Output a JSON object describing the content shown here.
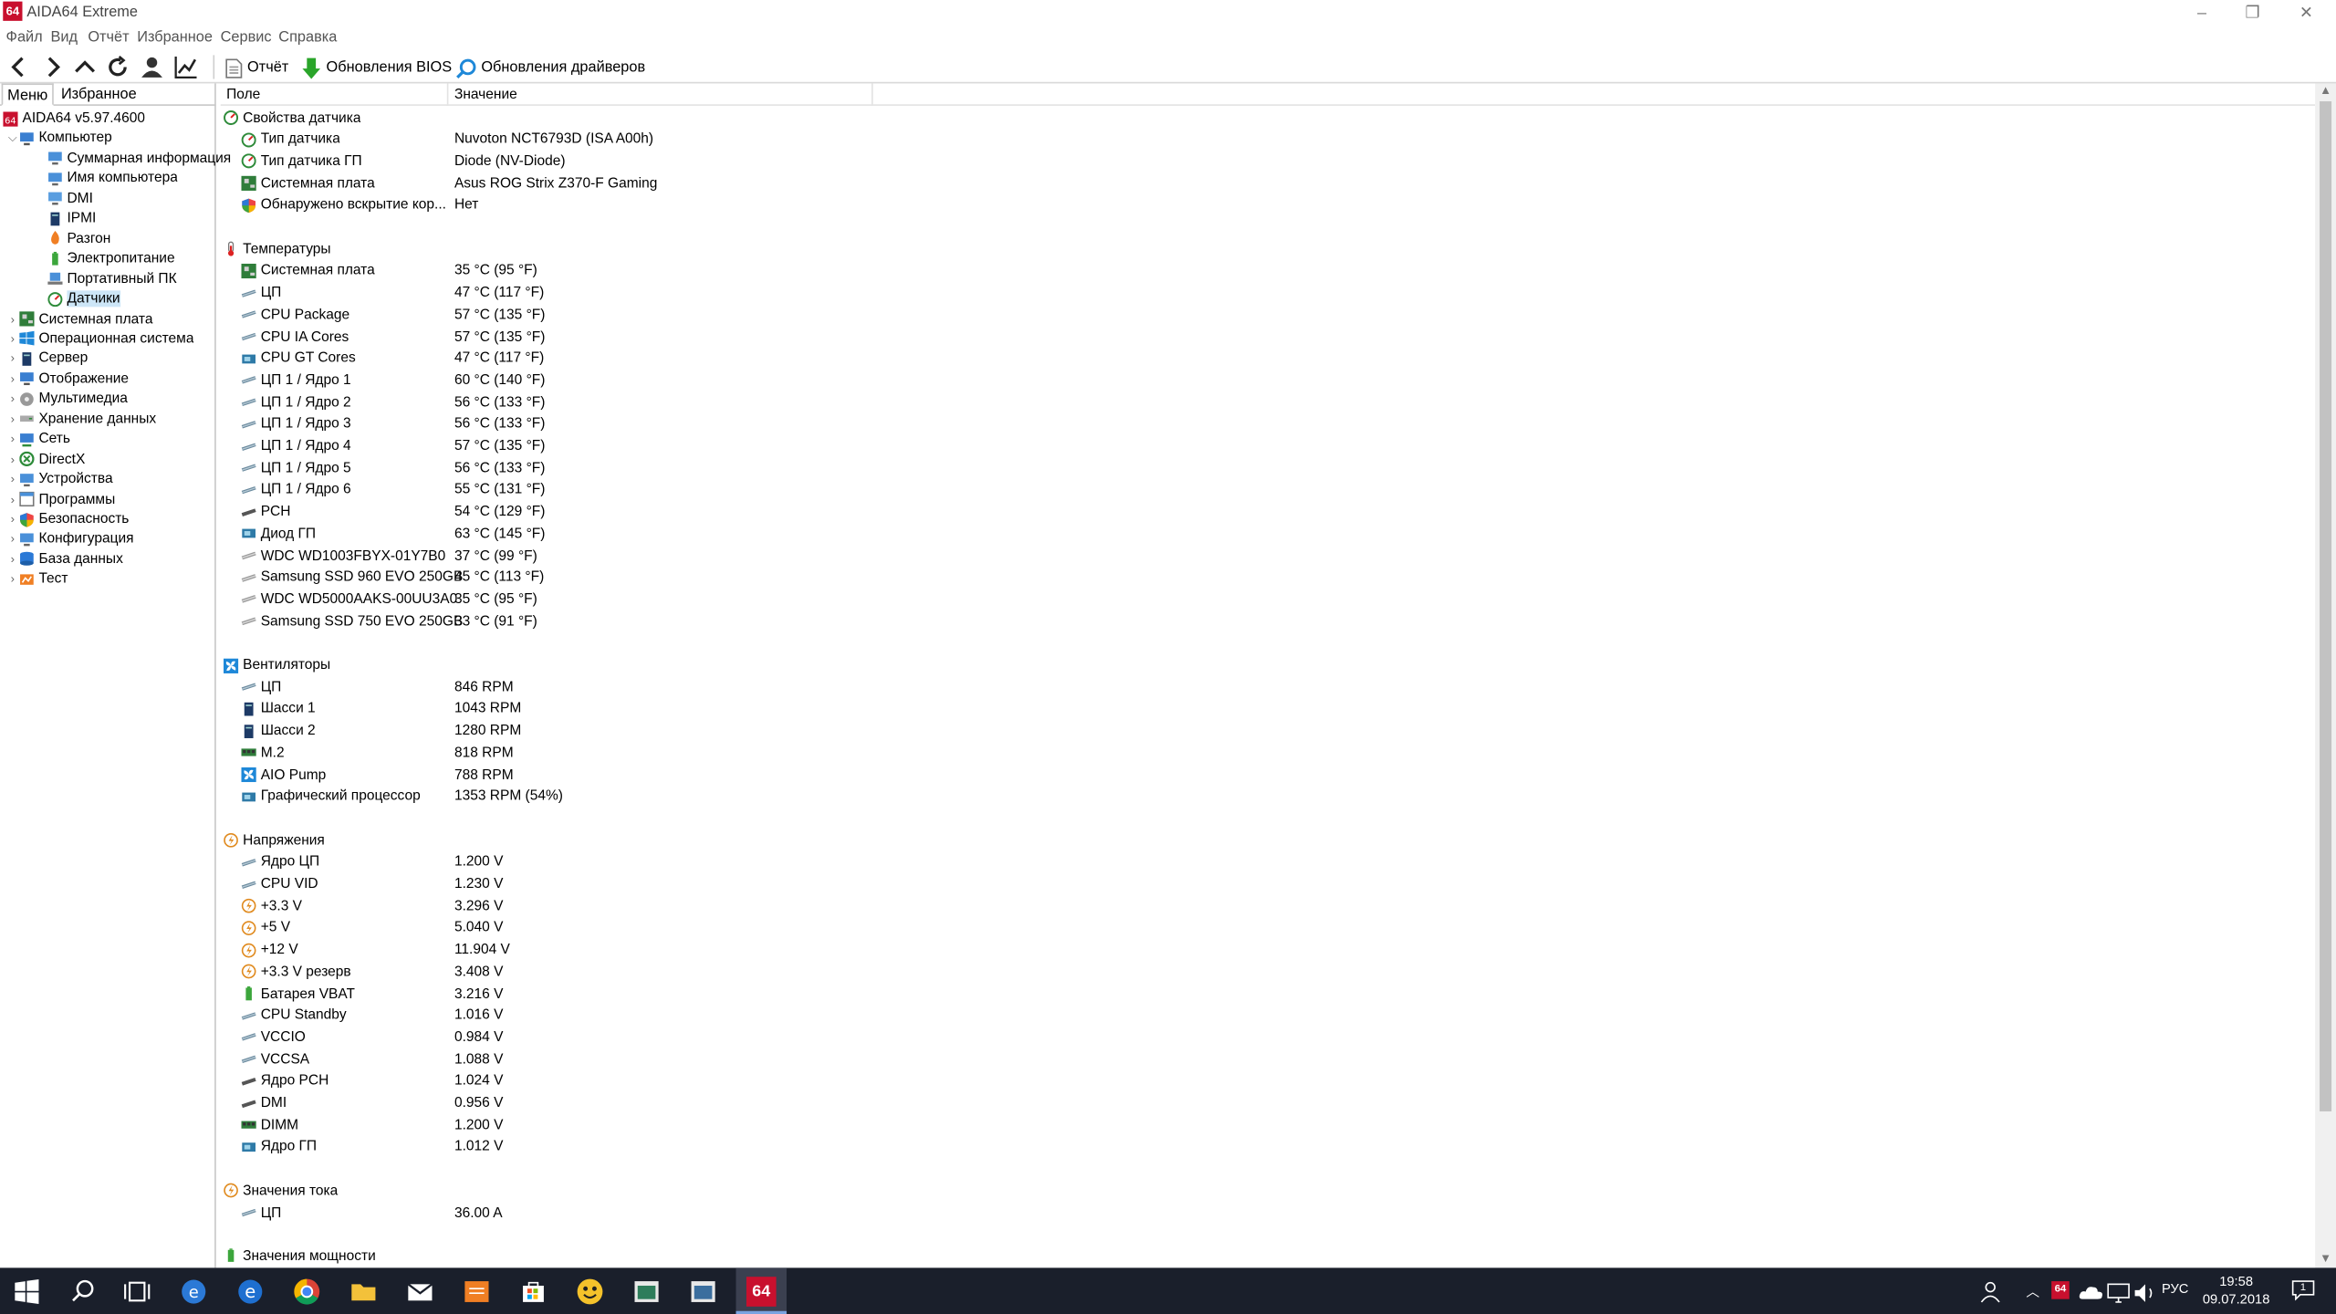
{
  "window": {
    "title": "AIDA64 Extreme",
    "logo": "64",
    "controls": [
      "–",
      "❐",
      "✕"
    ]
  },
  "menu": [
    "Файл",
    "Вид",
    "Отчёт",
    "Избранное",
    "Сервис",
    "Справка"
  ],
  "toolbar": {
    "report": "Отчёт",
    "bios": "Обновления BIOS",
    "drivers": "Обновления драйверов"
  },
  "tabs": [
    "Меню",
    "Избранное"
  ],
  "tree": [
    {
      "label": "AIDA64 v5.97.4600",
      "level": 0,
      "icon": "aida-icon",
      "exp": ""
    },
    {
      "label": "Компьютер",
      "level": 1,
      "icon": "computer-icon",
      "exp": "⌵"
    },
    {
      "label": "Суммарная информация",
      "level": 2,
      "icon": "summary-icon",
      "exp": ""
    },
    {
      "label": "Имя компьютера",
      "level": 2,
      "icon": "computer-name-icon",
      "exp": ""
    },
    {
      "label": "DMI",
      "level": 2,
      "icon": "dmi-icon",
      "exp": ""
    },
    {
      "label": "IPMI",
      "level": 2,
      "icon": "ipmi-icon",
      "exp": ""
    },
    {
      "label": "Разгон",
      "level": 2,
      "icon": "overclock-icon",
      "exp": ""
    },
    {
      "label": "Электропитание",
      "level": 2,
      "icon": "power-icon",
      "exp": ""
    },
    {
      "label": "Портативный ПК",
      "level": 2,
      "icon": "portable-pc-icon",
      "exp": ""
    },
    {
      "label": "Датчики",
      "level": 2,
      "icon": "sensor-icon",
      "exp": "",
      "selected": true
    },
    {
      "label": "Системная плата",
      "level": 1,
      "icon": "motherboard-icon",
      "exp": "›"
    },
    {
      "label": "Операционная система",
      "level": 1,
      "icon": "windows-icon",
      "exp": "›"
    },
    {
      "label": "Сервер",
      "level": 1,
      "icon": "server-icon",
      "exp": "›"
    },
    {
      "label": "Отображение",
      "level": 1,
      "icon": "display-icon",
      "exp": "›"
    },
    {
      "label": "Мультимедиа",
      "level": 1,
      "icon": "multimedia-icon",
      "exp": "›"
    },
    {
      "label": "Хранение данных",
      "level": 1,
      "icon": "storage-icon",
      "exp": "›"
    },
    {
      "label": "Сеть",
      "level": 1,
      "icon": "network-icon",
      "exp": "›"
    },
    {
      "label": "DirectX",
      "level": 1,
      "icon": "directx-icon",
      "exp": "›"
    },
    {
      "label": "Устройства",
      "level": 1,
      "icon": "devices-icon",
      "exp": "›"
    },
    {
      "label": "Программы",
      "level": 1,
      "icon": "programs-icon",
      "exp": "›"
    },
    {
      "label": "Безопасность",
      "level": 1,
      "icon": "security-icon",
      "exp": "›"
    },
    {
      "label": "Конфигурация",
      "level": 1,
      "icon": "config-icon",
      "exp": "›"
    },
    {
      "label": "База данных",
      "level": 1,
      "icon": "database-icon",
      "exp": "›"
    },
    {
      "label": "Тест",
      "level": 1,
      "icon": "benchmark-icon",
      "exp": "›"
    }
  ],
  "columns": {
    "field": "Поле",
    "value": "Значение"
  },
  "sections": [
    {
      "title": "Свойства датчика",
      "icon": "sensor-icon",
      "items": [
        {
          "f": "Тип датчика",
          "v": "Nuvoton NCT6793D  (ISA A00h)",
          "icon": "sensor-icon"
        },
        {
          "f": "Тип датчика ГП",
          "v": "Diode  (NV-Diode)",
          "icon": "sensor-icon"
        },
        {
          "f": "Системная плата",
          "v": "Asus ROG Strix Z370-F Gaming",
          "icon": "motherboard-icon"
        },
        {
          "f": "Обнаружено вскрытие кор...",
          "v": "Нет",
          "icon": "shield-icon"
        }
      ]
    },
    {
      "title": "Температуры",
      "icon": "thermometer-icon",
      "items": [
        {
          "f": "Системная плата",
          "v": "35 °C  (95 °F)",
          "icon": "motherboard-icon"
        },
        {
          "f": "ЦП",
          "v": "47 °C  (117 °F)",
          "icon": "cpu-icon"
        },
        {
          "f": "CPU Package",
          "v": "57 °C  (135 °F)",
          "icon": "cpu-icon"
        },
        {
          "f": "CPU IA Cores",
          "v": "57 °C  (135 °F)",
          "icon": "cpu-icon"
        },
        {
          "f": "CPU GT Cores",
          "v": "47 °C  (117 °F)",
          "icon": "gpu-icon"
        },
        {
          "f": "ЦП 1 / Ядро 1",
          "v": "60 °C  (140 °F)",
          "icon": "cpu-icon"
        },
        {
          "f": "ЦП 1 / Ядро 2",
          "v": "56 °C  (133 °F)",
          "icon": "cpu-icon"
        },
        {
          "f": "ЦП 1 / Ядро 3",
          "v": "56 °C  (133 °F)",
          "icon": "cpu-icon"
        },
        {
          "f": "ЦП 1 / Ядро 4",
          "v": "57 °C  (135 °F)",
          "icon": "cpu-icon"
        },
        {
          "f": "ЦП 1 / Ядро 5",
          "v": "56 °C  (133 °F)",
          "icon": "cpu-icon"
        },
        {
          "f": "ЦП 1 / Ядро 6",
          "v": "55 °C  (131 °F)",
          "icon": "cpu-icon"
        },
        {
          "f": "PCH",
          "v": "54 °C  (129 °F)",
          "icon": "chip-icon"
        },
        {
          "f": "Диод ГП",
          "v": "63 °C  (145 °F)",
          "icon": "gpu-icon"
        },
        {
          "f": "WDC WD1003FBYX-01Y7B0",
          "v": "37 °C  (99 °F)",
          "icon": "drive-icon"
        },
        {
          "f": "Samsung SSD 960 EVO 250GB",
          "v": "45 °C  (113 °F)",
          "icon": "drive-icon"
        },
        {
          "f": "WDC WD5000AAKS-00UU3A0",
          "v": "35 °C  (95 °F)",
          "icon": "drive-icon"
        },
        {
          "f": "Samsung SSD 750 EVO 250GB",
          "v": "33 °C  (91 °F)",
          "icon": "drive-icon"
        }
      ]
    },
    {
      "title": "Вентиляторы",
      "icon": "fan-icon",
      "items": [
        {
          "f": "ЦП",
          "v": "846 RPM",
          "icon": "cpu-icon"
        },
        {
          "f": "Шасси 1",
          "v": "1043 RPM",
          "icon": "case-icon"
        },
        {
          "f": "Шасси 2",
          "v": "1280 RPM",
          "icon": "case-icon"
        },
        {
          "f": "M.2",
          "v": "818 RPM",
          "icon": "memory-icon"
        },
        {
          "f": "AIO Pump",
          "v": "788 RPM",
          "icon": "fan-icon"
        },
        {
          "f": "Графический процессор",
          "v": "1353 RPM  (54%)",
          "icon": "gpu-icon"
        }
      ]
    },
    {
      "title": "Напряжения",
      "icon": "voltage-icon",
      "items": [
        {
          "f": "Ядро ЦП",
          "v": "1.200 V",
          "icon": "cpu-icon"
        },
        {
          "f": "CPU VID",
          "v": "1.230 V",
          "icon": "cpu-icon"
        },
        {
          "f": "+3.3 V",
          "v": "3.296 V",
          "icon": "voltage-icon"
        },
        {
          "f": "+5 V",
          "v": "5.040 V",
          "icon": "voltage-icon"
        },
        {
          "f": "+12 V",
          "v": "11.904 V",
          "icon": "voltage-icon"
        },
        {
          "f": "+3.3 V резерв",
          "v": "3.408 V",
          "icon": "voltage-icon"
        },
        {
          "f": "Батарея VBAT",
          "v": "3.216 V",
          "icon": "battery-icon"
        },
        {
          "f": "CPU Standby",
          "v": "1.016 V",
          "icon": "cpu-icon"
        },
        {
          "f": "VCCIO",
          "v": "0.984 V",
          "icon": "cpu-icon"
        },
        {
          "f": "VCCSA",
          "v": "1.088 V",
          "icon": "cpu-icon"
        },
        {
          "f": "Ядро PCH",
          "v": "1.024 V",
          "icon": "chip-icon"
        },
        {
          "f": "DMI",
          "v": "0.956 V",
          "icon": "chip-icon"
        },
        {
          "f": "DIMM",
          "v": "1.200 V",
          "icon": "memory-icon"
        },
        {
          "f": "Ядро ГП",
          "v": "1.012 V",
          "icon": "gpu-icon"
        }
      ]
    },
    {
      "title": "Значения тока",
      "icon": "current-icon",
      "items": [
        {
          "f": "ЦП",
          "v": "36.00 A",
          "icon": "cpu-icon"
        }
      ]
    },
    {
      "title": "Значения мощности",
      "icon": "power-icon",
      "items": []
    }
  ],
  "taskbar": {
    "tray_lang": "РУС",
    "time": "19:58",
    "date": "09.07.2018",
    "notif": "1",
    "aida_logo": "64"
  },
  "colors": {
    "accent": "#c8102e",
    "taskbar": "#1a1f2b",
    "selection": "#cde6f7",
    "toolbar_green": "#2aa52a"
  }
}
